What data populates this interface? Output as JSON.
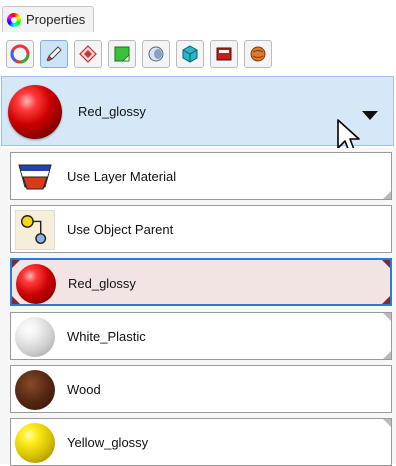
{
  "tab": {
    "label": "Properties",
    "icon": "color-wheel-icon"
  },
  "toolbar": {
    "buttons": [
      {
        "icon": "object-color-icon",
        "active": false
      },
      {
        "icon": "material-brush-icon",
        "active": true
      },
      {
        "icon": "decal-icon",
        "active": false
      },
      {
        "icon": "texture-mapping-icon",
        "active": false
      },
      {
        "icon": "shadow-icon",
        "active": false
      },
      {
        "icon": "render-mesh-icon",
        "active": false
      },
      {
        "icon": "display-icon",
        "active": false
      },
      {
        "icon": "environment-icon",
        "active": false
      }
    ]
  },
  "selector": {
    "current": "Red_glossy"
  },
  "list": {
    "items": [
      {
        "label": "Use Layer Material",
        "icon": "layer-material-icon",
        "selected": false
      },
      {
        "label": "Use Object Parent",
        "icon": "object-parent-icon",
        "selected": false
      },
      {
        "label": "Red_glossy",
        "icon": "red-sphere-icon",
        "selected": true
      },
      {
        "label": "White_Plastic",
        "icon": "white-sphere-icon",
        "selected": false
      },
      {
        "label": "Wood",
        "icon": "wood-sphere-icon",
        "selected": false
      },
      {
        "label": "Yellow_glossy",
        "icon": "yellow-sphere-icon",
        "selected": false
      }
    ]
  },
  "colors": {
    "accent": "#2b7bd6",
    "selector_bg": "#d6e8f8",
    "selected_item_bg": "#f3e4e4"
  }
}
